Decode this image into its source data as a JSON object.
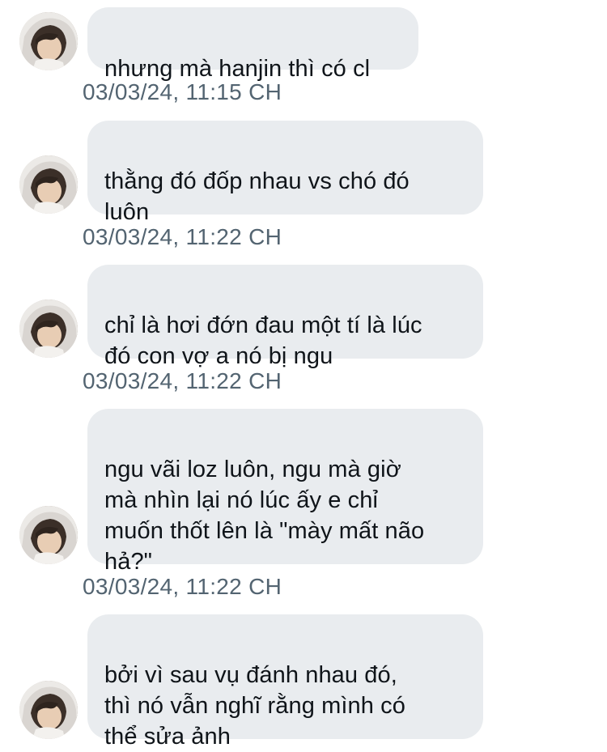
{
  "conversation": {
    "messages": [
      {
        "text": "nhưng mà hanjin thì có cl",
        "timestamp": "03/03/24, 11:15 CH"
      },
      {
        "text": "thằng đó đốp nhau vs chó đó\nluôn",
        "timestamp": "03/03/24, 11:22 CH"
      },
      {
        "text": "chỉ là hơi đớn đau một tí là lúc\nđó con vợ a nó bị ngu",
        "timestamp": "03/03/24, 11:22 CH"
      },
      {
        "text": "ngu vãi loz luôn, ngu mà giờ\nmà nhìn lại nó lúc ấy e chỉ\nmuốn thốt lên là \"mày mất não\nhả?\"",
        "timestamp": "03/03/24, 11:22 CH"
      },
      {
        "text": "bởi vì sau vụ đánh nhau đó,\nthì nó vẫn nghĩ rằng mình có\nthể sửa ảnh",
        "timestamp": ""
      }
    ]
  },
  "colors": {
    "bubble_bg": "#e9ecef",
    "message_text": "#0f1419",
    "timestamp_text": "#536471"
  },
  "icons": {
    "avatar": "user-avatar-photo"
  }
}
